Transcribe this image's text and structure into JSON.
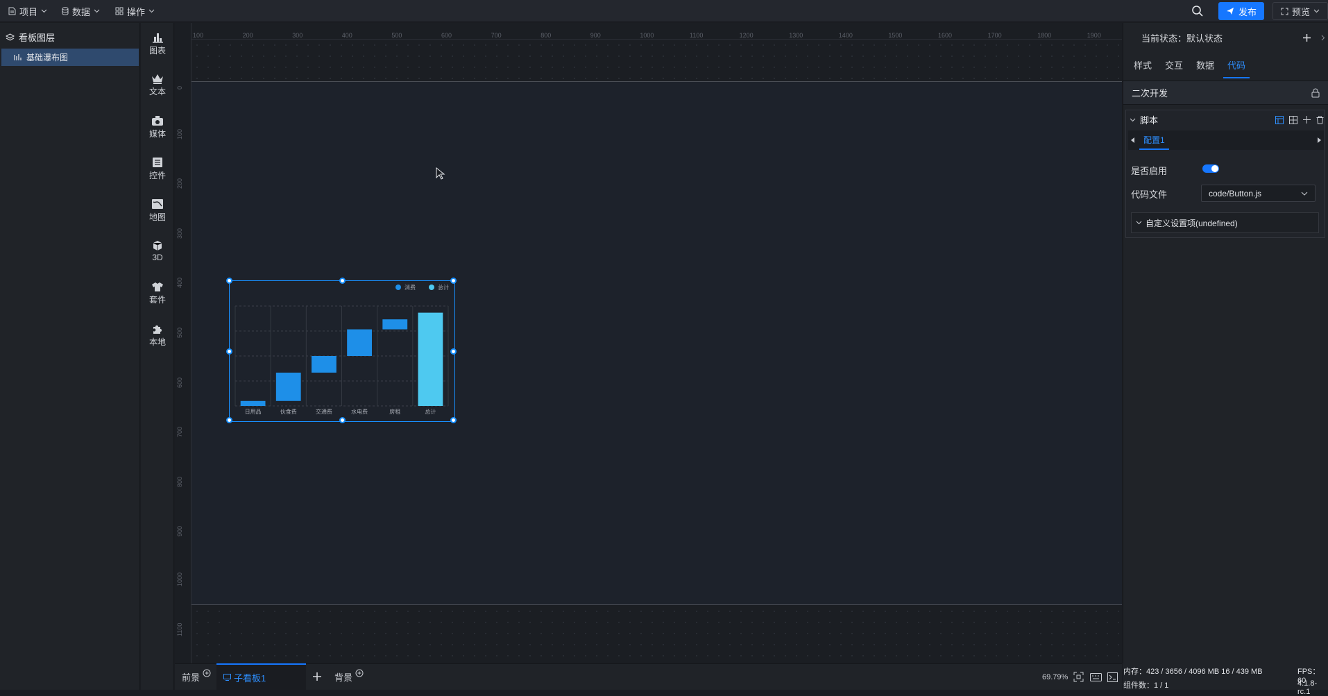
{
  "topbar": {
    "menus": [
      {
        "label": "项目",
        "icon": "file-icon"
      },
      {
        "label": "数据",
        "icon": "database-icon"
      },
      {
        "label": "操作",
        "icon": "grid-icon"
      }
    ],
    "publish_label": "发布",
    "preview_label": "预览"
  },
  "layers": {
    "title": "看板图层",
    "items": [
      {
        "label": "基础瀑布图",
        "icon": "waterfall-chart-icon"
      }
    ]
  },
  "toolbox": [
    {
      "label": "图表",
      "icon": "bar-chart-icon"
    },
    {
      "label": "文本",
      "icon": "crown-text-icon"
    },
    {
      "label": "媒体",
      "icon": "media-icon"
    },
    {
      "label": "控件",
      "icon": "controls-icon"
    },
    {
      "label": "地图",
      "icon": "map-icon"
    },
    {
      "label": "3D",
      "icon": "cube-icon"
    },
    {
      "label": "套件",
      "icon": "shirt-icon"
    },
    {
      "label": "本地",
      "icon": "puzzle-icon"
    }
  ],
  "ruler": {
    "top": [
      "100",
      "200",
      "300",
      "400",
      "500",
      "600",
      "700",
      "800",
      "900",
      "1000",
      "1100",
      "1200",
      "1300",
      "1400",
      "1500",
      "1600",
      "1700",
      "1800",
      "1900"
    ],
    "left": [
      "0",
      "100",
      "200",
      "300",
      "400",
      "500",
      "600",
      "700",
      "800",
      "900",
      "1000",
      "1100",
      "1200"
    ]
  },
  "chart_data": {
    "type": "bar",
    "subtype": "waterfall",
    "categories": [
      "日用品",
      "伙食费",
      "交通费",
      "水电费",
      "房租",
      "总计"
    ],
    "series": [
      {
        "name": "消费",
        "color": "#1e8fe8",
        "ranges": [
          [
            0,
            150
          ],
          [
            150,
            1000
          ],
          [
            1000,
            1500
          ],
          [
            1500,
            2300
          ],
          [
            2300,
            2600
          ],
          null
        ]
      },
      {
        "name": "总计",
        "color": "#4ec9f0",
        "ranges": [
          null,
          null,
          null,
          null,
          null,
          [
            0,
            2800
          ]
        ]
      }
    ],
    "ylim": [
      0,
      3000
    ],
    "grid": true,
    "legend": "top-right"
  },
  "bottombar": {
    "tabs": [
      {
        "label": "前景"
      },
      {
        "label": "子看板1"
      },
      {
        "label": "背景"
      }
    ],
    "zoom": "69.79%"
  },
  "props": {
    "state_label": "当前状态：",
    "state_value": "默认状态",
    "tabs": [
      "样式",
      "交互",
      "数据",
      "代码"
    ],
    "active_tab": "代码",
    "section": "二次开发",
    "script_title": "脚本",
    "config_tab": "配置1",
    "enable_label": "是否启用",
    "enable_value": true,
    "codefile_label": "代码文件",
    "codefile_value": "code/Button.js",
    "custom_label": "自定义设置项(undefined)"
  },
  "status": {
    "memory": "内存：423 / 3656 / 4096 MB 16 / 439 MB",
    "fps": "FPS：60",
    "components": "组件数：1 / 1",
    "version": "4.1.8-rc.1"
  },
  "colors": {
    "accent": "#1677ff",
    "bar_main": "#1e8fe8",
    "bar_total": "#4ec9f0"
  }
}
